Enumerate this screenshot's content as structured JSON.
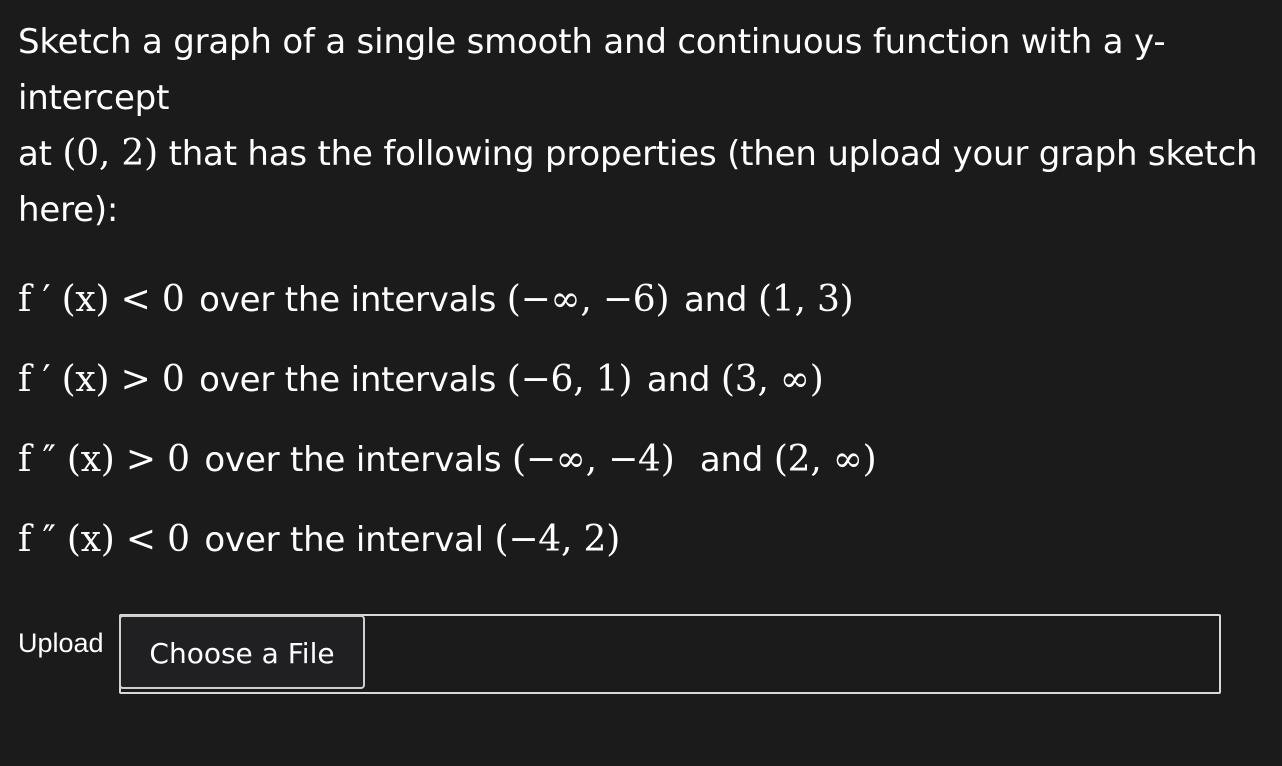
{
  "question": {
    "line1_text": "Sketch a graph of a single smooth and continuous function with a y-intercept",
    "line2_prefix": "at ",
    "line2_point": "(0, 2)",
    "line2_suffix": " that has the following properties (then upload your graph sketch",
    "line3_text": "here):"
  },
  "properties": [
    {
      "expr": "f ′ (x) < 0",
      "text_a": " over the intervals ",
      "interval_a": "(−∞, −6)",
      "connector": " and ",
      "interval_b": "(1, 3)"
    },
    {
      "expr": "f ′ (x) > 0",
      "text_a": " over the intervals ",
      "interval_a": "(−6, 1)",
      "connector": " and ",
      "interval_b": "(3, ∞)"
    },
    {
      "expr": "f ″ (x) > 0",
      "text_a": " over the intervals ",
      "interval_a": "(−∞, −4)",
      "connector": "  and ",
      "interval_b": "(2, ∞)"
    },
    {
      "expr": "f ″ (x) < 0",
      "text_a": " over the interval ",
      "interval_a": "(−4, 2)",
      "connector": "",
      "interval_b": ""
    }
  ],
  "upload": {
    "label": "Upload",
    "button_label": "Choose a File"
  }
}
